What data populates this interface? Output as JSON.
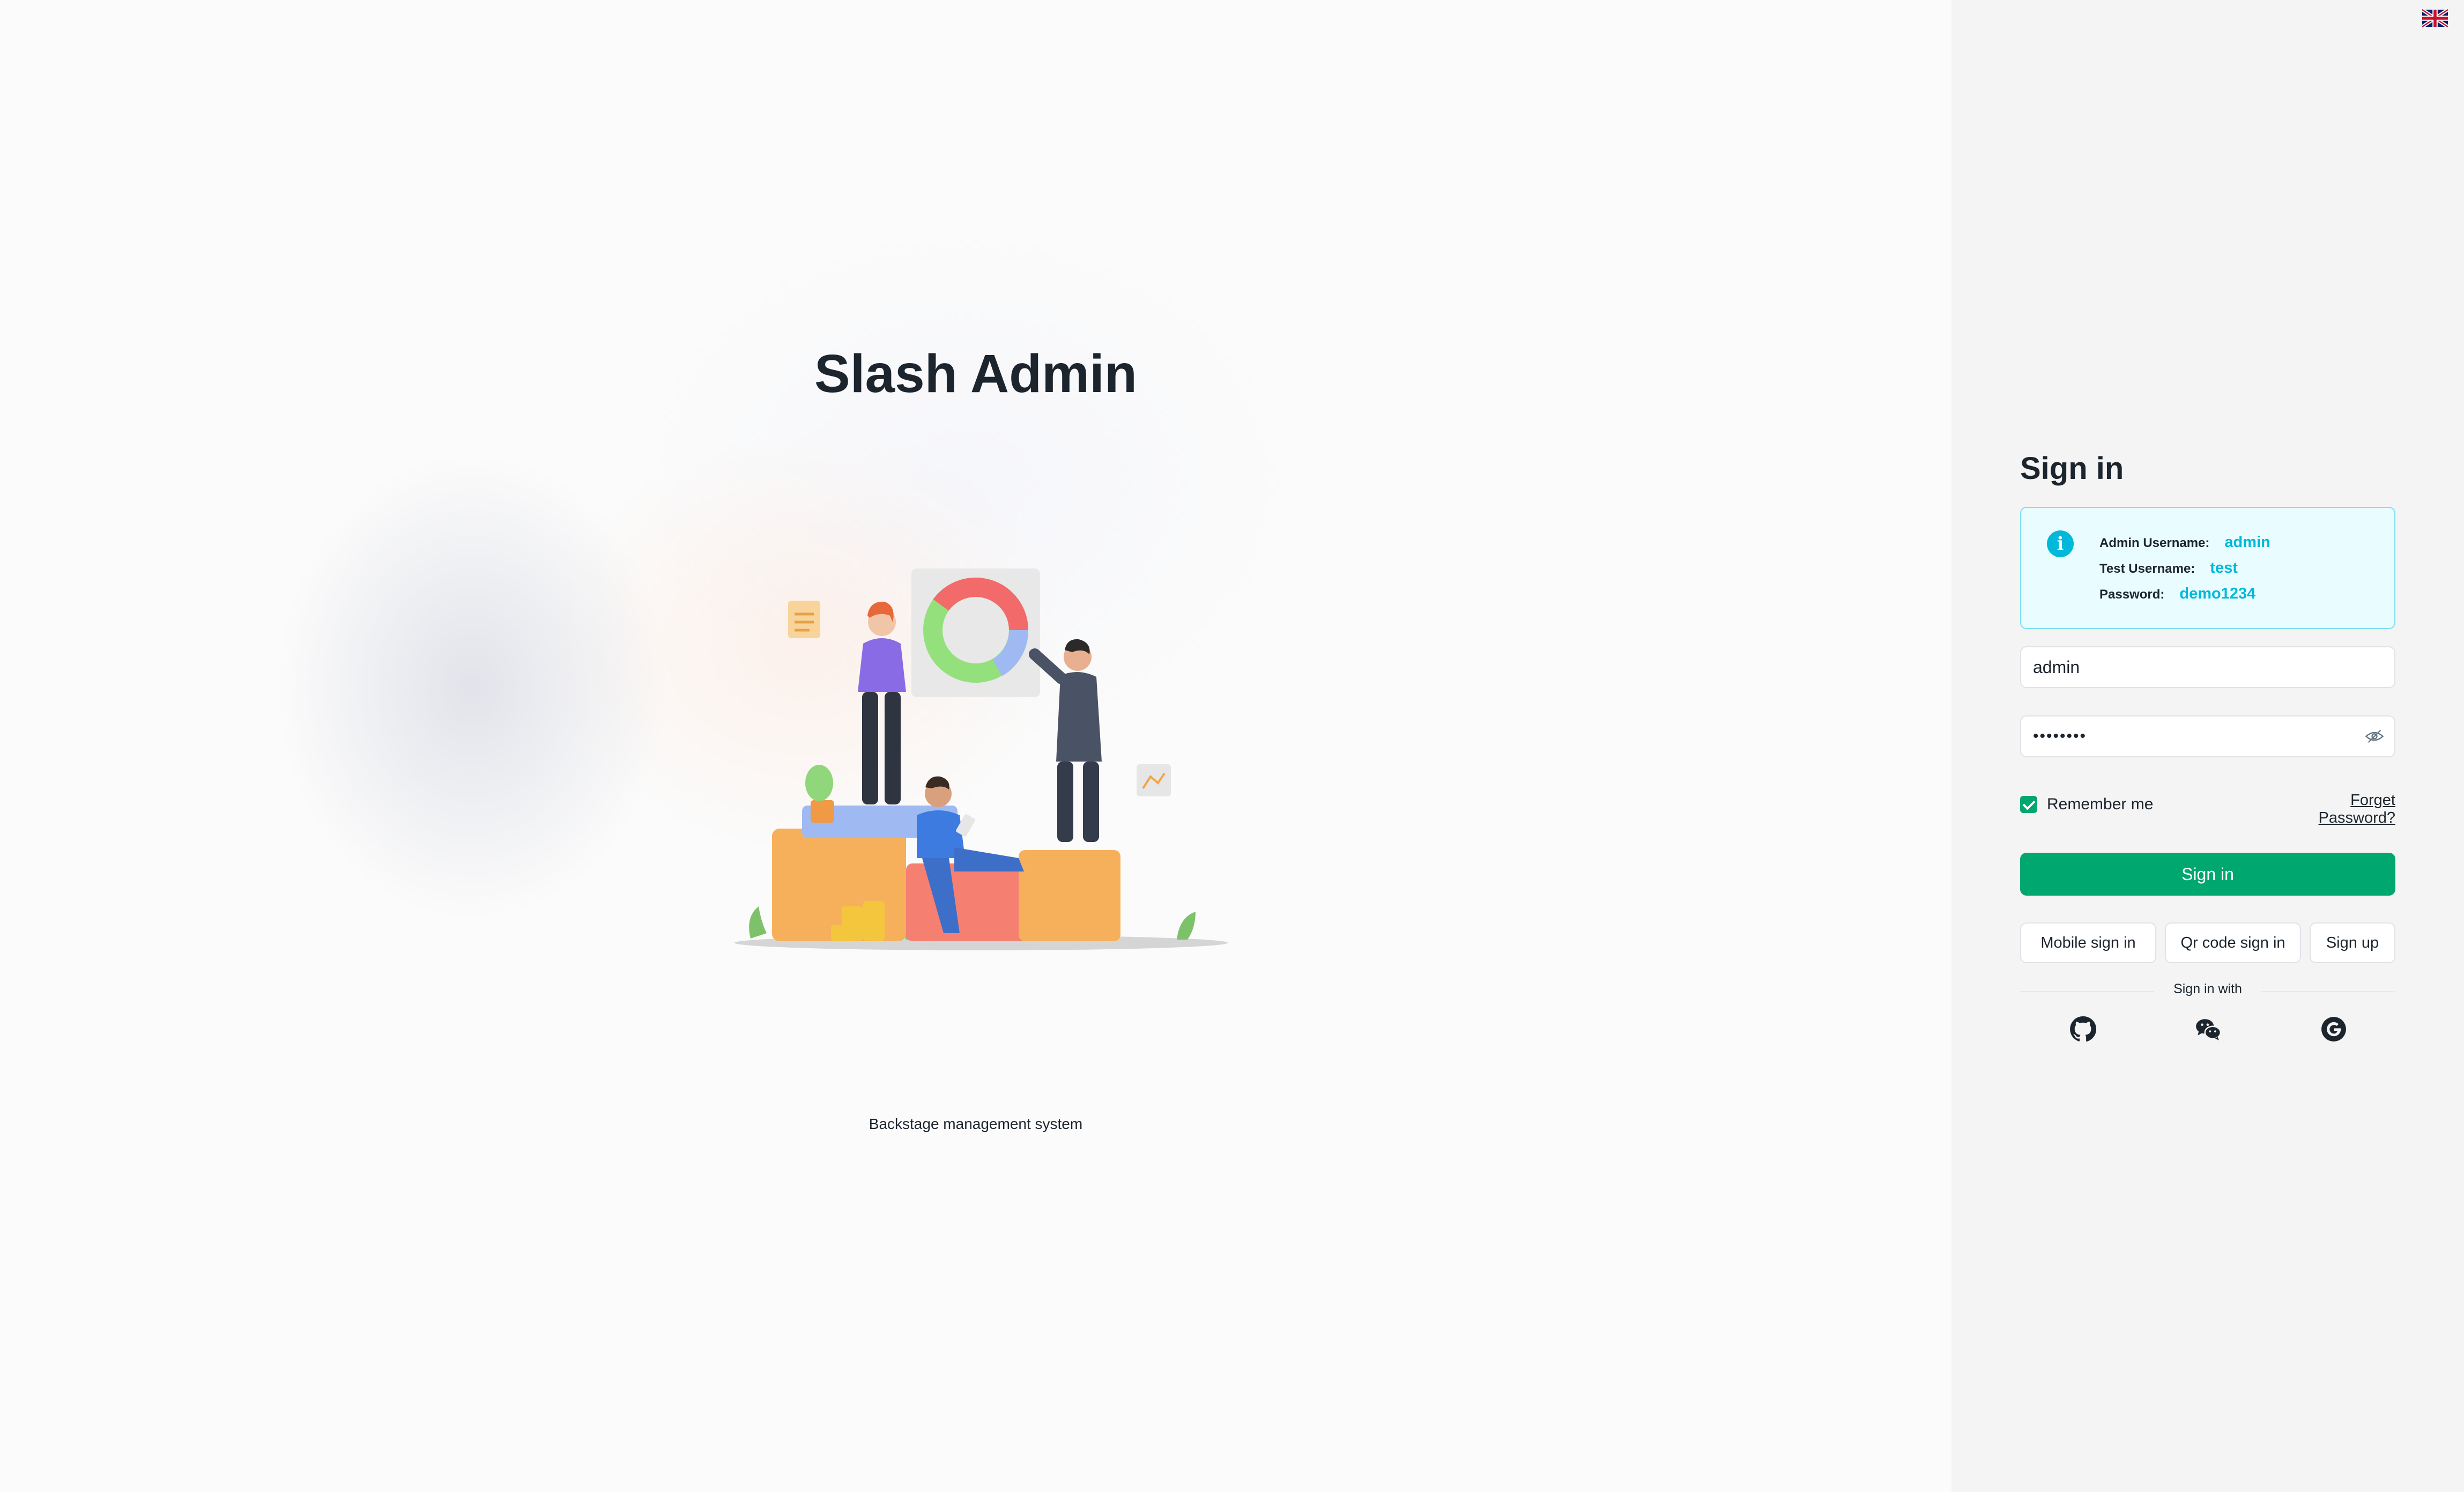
{
  "app": {
    "title": "Slash Admin",
    "subtitle": "Backstage management system"
  },
  "language": {
    "icon": "uk-flag-icon"
  },
  "signin": {
    "title": "Sign in",
    "alert": {
      "icon": "info-icon",
      "rows": [
        {
          "label": "Admin Username:",
          "value": "admin"
        },
        {
          "label": "Test Username:",
          "value": "test"
        },
        {
          "label": "Password:",
          "value": "demo1234"
        }
      ]
    },
    "username": {
      "value": "admin"
    },
    "password": {
      "masked": "••••••••",
      "toggle_icon": "eye-off-icon"
    },
    "remember": {
      "label": "Remember me",
      "checked": true
    },
    "forgot_label": "Forget Password?",
    "submit_label": "Sign in",
    "alt_buttons": {
      "mobile": "Mobile sign in",
      "qr": "Qr code sign in",
      "signup": "Sign up"
    },
    "divider": "Sign in with",
    "social": [
      "github-icon",
      "wechat-icon",
      "google-icon"
    ]
  },
  "colors": {
    "primary": "#00a76f",
    "info": "#00b8d9",
    "text": "#1c252e",
    "panel_bg": "#f4f4f4"
  }
}
